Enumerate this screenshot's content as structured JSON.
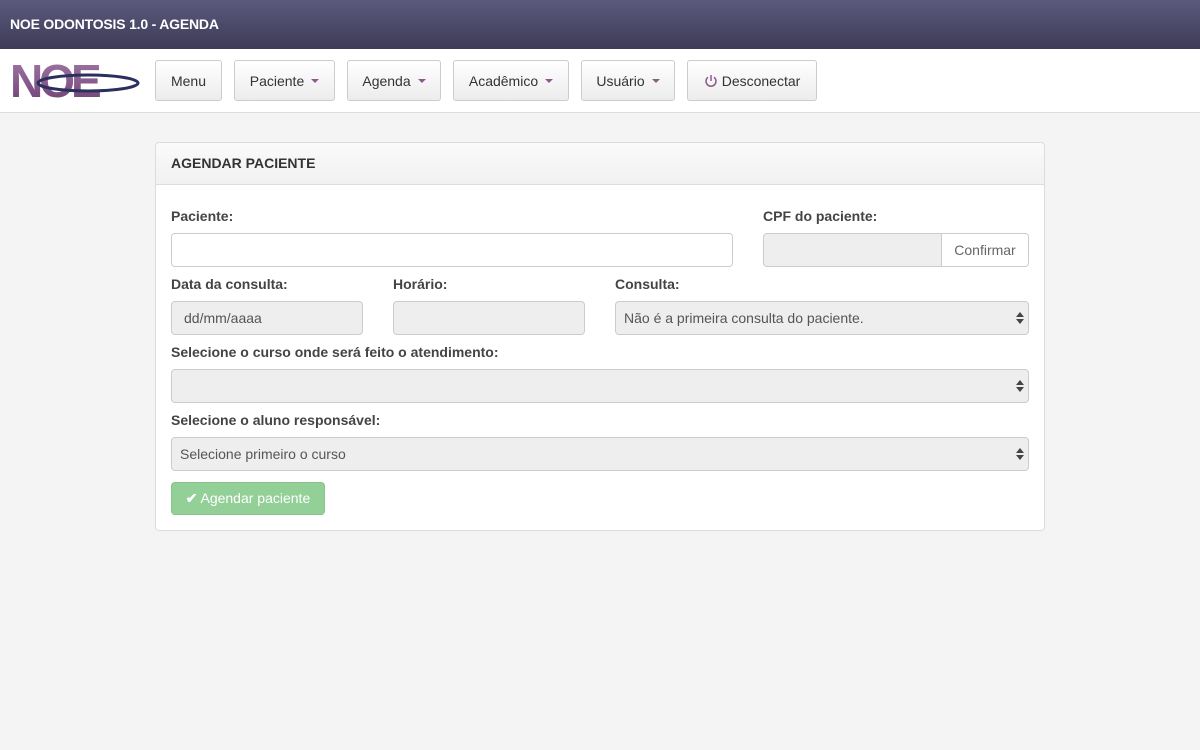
{
  "window": {
    "title": "NOE ODONTOSIS 1.0 - AGENDA"
  },
  "colors": {
    "header": "#4a4867",
    "accent": "#8e5a8e",
    "success": "#92d098"
  },
  "nav": {
    "menu": "Menu",
    "paciente": "Paciente",
    "agenda": "Agenda",
    "academico": "Acadêmico",
    "usuario": "Usuário",
    "desconectar": "Desconectar"
  },
  "panel": {
    "title": "AGENDAR PACIENTE"
  },
  "form": {
    "paciente_label": "Paciente:",
    "paciente_value": "",
    "cpf_label": "CPF do paciente:",
    "cpf_value": "",
    "confirmar": "Confirmar",
    "data_label": "Data da consulta:",
    "data_value": "dd/mm/aaaa",
    "horario_label": "Horário:",
    "horario_value": "",
    "consulta_label": "Consulta:",
    "consulta_value": "Não é a primeira consulta do paciente.",
    "curso_label": "Selecione o curso onde será feito o atendimento:",
    "curso_value": "",
    "aluno_label": "Selecione o aluno responsável:",
    "aluno_value": "Selecione primeiro o curso",
    "submit": "Agendar paciente"
  }
}
